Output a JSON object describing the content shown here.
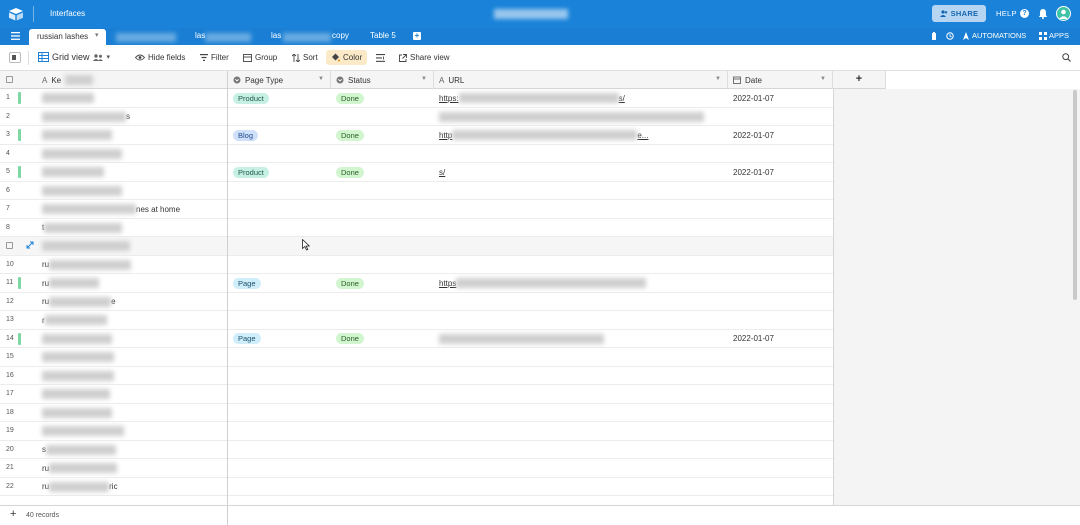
{
  "topbar": {
    "interfaces_label": "Interfaces",
    "share_label": "SHARE",
    "help_label": "HELP"
  },
  "tabs": {
    "active": "russian lashes",
    "items": [
      {
        "label": "las"
      },
      {
        "label": "las",
        "suffix": "copy"
      },
      {
        "label": "Table 5"
      }
    ],
    "automations_label": "AUTOMATIONS",
    "apps_label": "APPS"
  },
  "toolbar": {
    "view_name": "Grid view",
    "hide_fields": "Hide fields",
    "filter": "Filter",
    "group": "Group",
    "sort": "Sort",
    "color": "Color",
    "share_view": "Share view"
  },
  "columns": {
    "key": "Ke",
    "page_type": "Page Type",
    "status": "Status",
    "url": "URL",
    "date": "Date",
    "add": "+"
  },
  "rows": [
    {
      "num": "1",
      "bar": true,
      "key_prefix": "",
      "key_suffix": "",
      "page_type": "Product",
      "status": "Done",
      "url_prefix": "https:",
      "url_suffix": "s/",
      "date": "2022-01-07"
    },
    {
      "num": "2",
      "bar": false,
      "key_prefix": "",
      "key_suffix": "s",
      "page_type": "",
      "status": "",
      "url_prefix": "",
      "url_suffix": "",
      "date": ""
    },
    {
      "num": "3",
      "bar": true,
      "key_prefix": "",
      "key_suffix": "",
      "page_type": "Blog",
      "status": "Done",
      "url_prefix": "http",
      "url_suffix": "e...",
      "date": "2022-01-07"
    },
    {
      "num": "4",
      "bar": false,
      "key_prefix": "",
      "key_suffix": "",
      "page_type": "",
      "status": "",
      "url_prefix": "",
      "url_suffix": "",
      "date": ""
    },
    {
      "num": "5",
      "bar": true,
      "key_prefix": "",
      "key_suffix": "",
      "page_type": "Product",
      "status": "Done",
      "url_prefix": "",
      "url_suffix": "s/",
      "date": "2022-01-07"
    },
    {
      "num": "6",
      "bar": false,
      "key_prefix": "",
      "key_suffix": "",
      "page_type": "",
      "status": "",
      "url_prefix": "",
      "url_suffix": "",
      "date": ""
    },
    {
      "num": "7",
      "bar": false,
      "key_prefix": "",
      "key_suffix": "nes at home",
      "page_type": "",
      "status": "",
      "url_prefix": "",
      "url_suffix": "",
      "date": ""
    },
    {
      "num": "8",
      "bar": false,
      "key_prefix": "t",
      "key_suffix": "",
      "page_type": "",
      "status": "",
      "url_prefix": "",
      "url_suffix": "",
      "date": ""
    },
    {
      "num": "",
      "bar": false,
      "hover": true,
      "key_prefix": "",
      "key_suffix": "",
      "page_type": "",
      "status": "",
      "url_prefix": "",
      "url_suffix": "",
      "date": ""
    },
    {
      "num": "10",
      "bar": false,
      "key_prefix": "ru",
      "key_suffix": "",
      "page_type": "",
      "status": "",
      "url_prefix": "",
      "url_suffix": "",
      "date": ""
    },
    {
      "num": "11",
      "bar": true,
      "key_prefix": "ru",
      "key_suffix": "",
      "page_type": "Page",
      "status": "Done",
      "url_prefix": "https",
      "url_suffix": "",
      "date": ""
    },
    {
      "num": "12",
      "bar": false,
      "key_prefix": "ru",
      "key_suffix": "e",
      "page_type": "",
      "status": "",
      "url_prefix": "",
      "url_suffix": "",
      "date": ""
    },
    {
      "num": "13",
      "bar": false,
      "key_prefix": "r",
      "key_suffix": "",
      "page_type": "",
      "status": "",
      "url_prefix": "",
      "url_suffix": "",
      "date": ""
    },
    {
      "num": "14",
      "bar": true,
      "key_prefix": "",
      "key_suffix": "",
      "page_type": "Page",
      "status": "Done",
      "url_prefix": "",
      "url_suffix": "",
      "date": "2022-01-07"
    },
    {
      "num": "15",
      "bar": false,
      "key_prefix": "",
      "key_suffix": "",
      "page_type": "",
      "status": "",
      "url_prefix": "",
      "url_suffix": "",
      "date": ""
    },
    {
      "num": "16",
      "bar": false,
      "key_prefix": "",
      "key_suffix": "",
      "page_type": "",
      "status": "",
      "url_prefix": "",
      "url_suffix": "",
      "date": ""
    },
    {
      "num": "17",
      "bar": false,
      "key_prefix": "",
      "key_suffix": "",
      "page_type": "",
      "status": "",
      "url_prefix": "",
      "url_suffix": "",
      "date": ""
    },
    {
      "num": "18",
      "bar": false,
      "key_prefix": "",
      "key_suffix": "",
      "page_type": "",
      "status": "",
      "url_prefix": "",
      "url_suffix": "",
      "date": ""
    },
    {
      "num": "19",
      "bar": false,
      "key_prefix": "",
      "key_suffix": "",
      "page_type": "",
      "status": "",
      "url_prefix": "",
      "url_suffix": "",
      "date": ""
    },
    {
      "num": "20",
      "bar": false,
      "key_prefix": "s",
      "key_suffix": "",
      "page_type": "",
      "status": "",
      "url_prefix": "",
      "url_suffix": "",
      "date": ""
    },
    {
      "num": "21",
      "bar": false,
      "key_prefix": "ru",
      "key_suffix": "",
      "page_type": "",
      "status": "",
      "url_prefix": "",
      "url_suffix": "",
      "date": ""
    },
    {
      "num": "22",
      "bar": false,
      "key_prefix": "ru",
      "key_suffix": "ric",
      "page_type": "",
      "status": "",
      "url_prefix": "",
      "url_suffix": "",
      "date": ""
    }
  ],
  "footer": {
    "records": "40 records"
  },
  "colors": {
    "topbar": "#1a83d9",
    "status_done": "#d1f5cf",
    "row_bar": "#7ed8a4",
    "color_chip": "#fce9c7"
  }
}
